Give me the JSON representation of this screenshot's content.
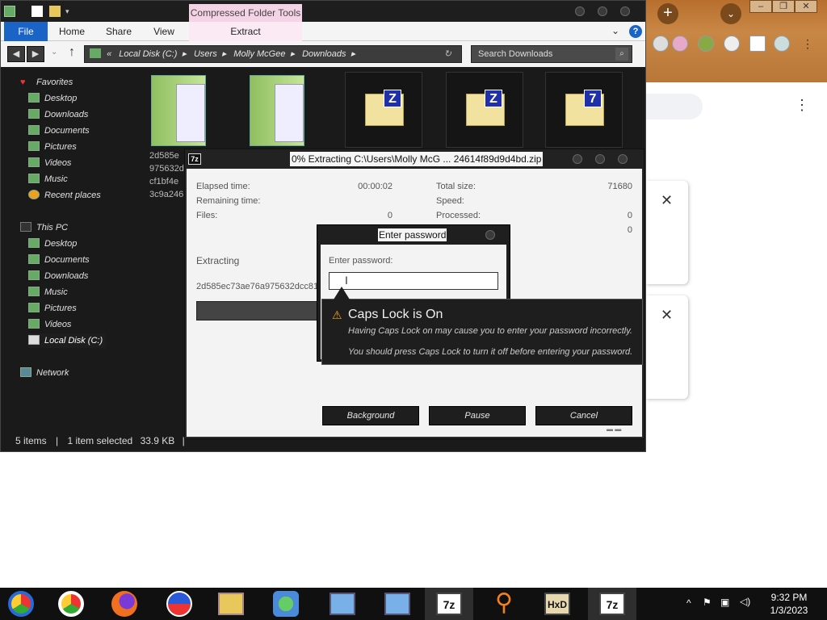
{
  "explorer": {
    "contextual_tab": "Compressed Folder Tools",
    "ribbon": {
      "file": "File",
      "home": "Home",
      "share": "Share",
      "view": "View",
      "extract": "Extract"
    },
    "address": {
      "prefix": "«",
      "crumbs": [
        "Local Disk (C:)",
        "Users",
        "Molly McGee",
        "Downloads"
      ]
    },
    "search_placeholder": "Search Downloads",
    "nav": {
      "favorites": "Favorites",
      "fav_items": [
        "Desktop",
        "Downloads",
        "Documents",
        "Pictures",
        "Videos",
        "Music",
        "Recent places"
      ],
      "this_pc": "This PC",
      "pc_items": [
        "Desktop",
        "Documents",
        "Downloads",
        "Music",
        "Pictures",
        "Videos",
        "Local Disk (C:)"
      ],
      "network": "Network"
    },
    "file_caption": [
      "2d585e",
      "975632d",
      "cf1bf4e",
      "3c9a246"
    ],
    "zip_badges": [
      "Z",
      "Z",
      "7"
    ],
    "status": {
      "items": "5 items",
      "selected": "1 item selected",
      "size": "33.9 KB"
    }
  },
  "zip_dialog": {
    "icon": "7z",
    "title": "0% Extracting C:\\Users\\Molly McG ... 24614f89d9d4bd.zip",
    "elapsed_label": "Elapsed time:",
    "elapsed_value": "00:00:02",
    "remaining_label": "Remaining time:",
    "files_label": "Files:",
    "files_value": "0",
    "total_label": "Total size:",
    "total_value": "71680",
    "speed_label": "Speed:",
    "processed_label": "Processed:",
    "processed_value": "0",
    "extra_value": "0",
    "extracting_label": "Extracting",
    "current_file": "2d585ec73ae76a975632dcc81",
    "progress": 0,
    "buttons": {
      "background": "Background",
      "pause": "Pause",
      "cancel": "Cancel"
    }
  },
  "password_dialog": {
    "title": "Enter password",
    "label": "Enter password:",
    "value": ""
  },
  "caps_tooltip": {
    "title": "Caps Lock is On",
    "line1": "Having Caps Lock on may cause you to enter your password incorrectly.",
    "line2": "You should press Caps Lock to turn it off before entering your password."
  },
  "chrome": {
    "new_tab": "+",
    "window_buttons": [
      "–",
      "❐",
      "✕"
    ],
    "close_x": "✕",
    "menu_dots": "⋮"
  },
  "taskbar": {
    "apps": [
      "chrome-icon",
      "chrome-icon",
      "firefox-icon",
      "obama-icon",
      "file-explorer-icon",
      "network-icon",
      "remote-desktop-icon",
      "remote-desktop-icon",
      "7zip-icon",
      "search-icon",
      "hxd-icon",
      "7zip-icon"
    ],
    "box_labels": {
      "sevenzip": "7z",
      "hxd": "HxD"
    },
    "time": "9:32 PM",
    "date": "1/3/2023"
  }
}
